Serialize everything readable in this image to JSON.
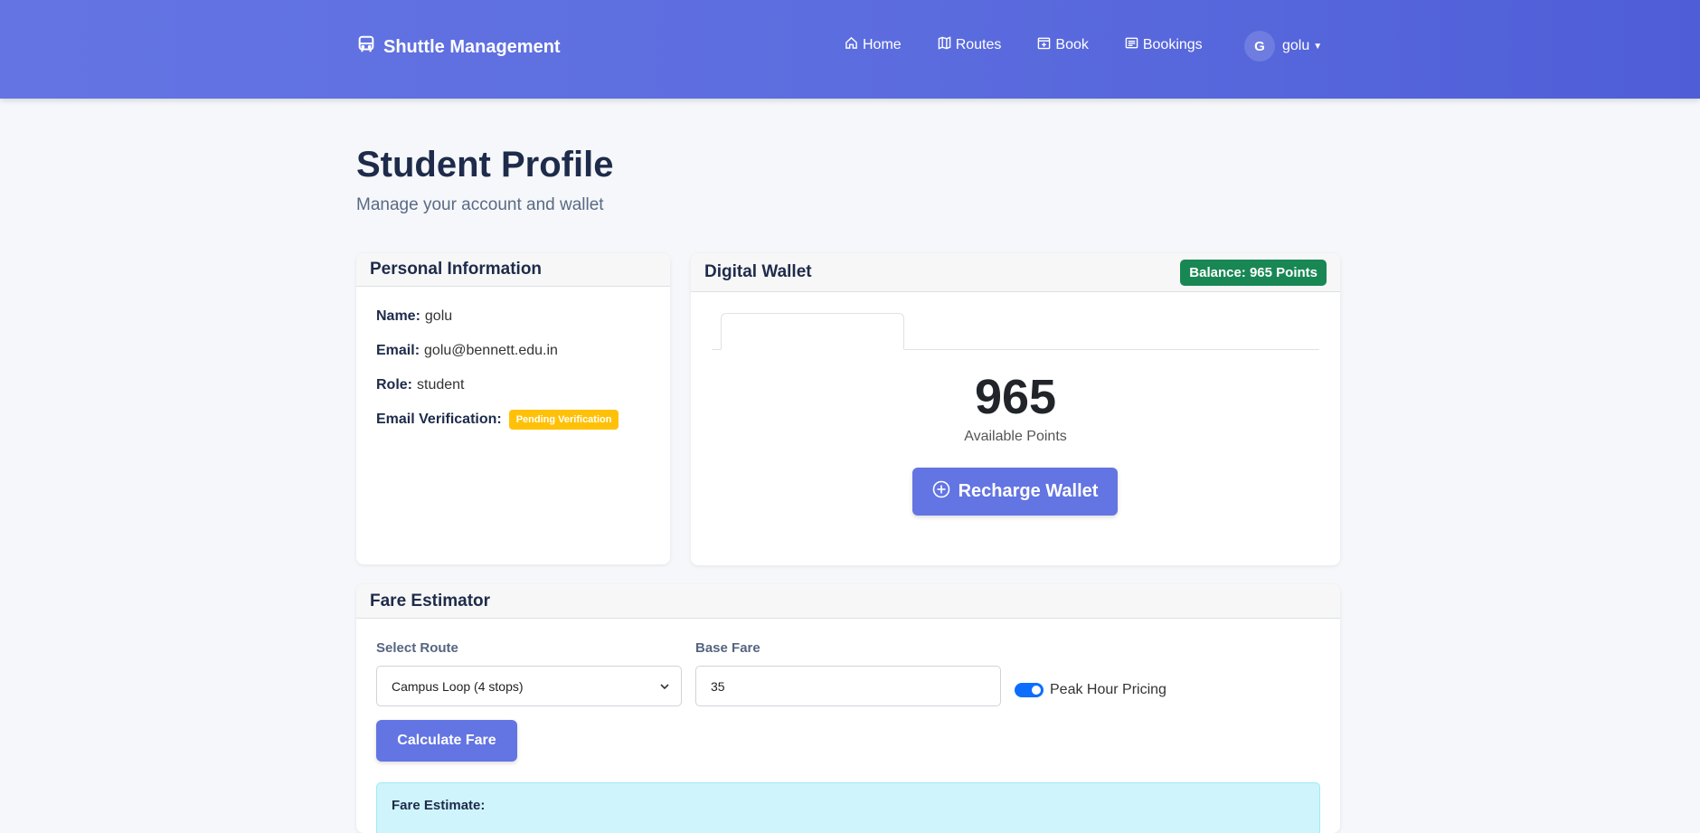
{
  "navbar": {
    "brand": "Shuttle Management",
    "links": [
      {
        "label": "Home",
        "icon": "home-icon"
      },
      {
        "label": "Routes",
        "icon": "map-icon"
      },
      {
        "label": "Book",
        "icon": "calendar-plus-icon"
      },
      {
        "label": "Bookings",
        "icon": "list-icon"
      }
    ],
    "user": {
      "initial": "G",
      "name": "golu"
    }
  },
  "header": {
    "title": "Student Profile",
    "subtitle": "Manage your account and wallet"
  },
  "personal_info": {
    "title": "Personal Information",
    "name_label": "Name:",
    "name_value": "golu",
    "email_label": "Email:",
    "email_value": "golu@bennett.edu.in",
    "role_label": "Role:",
    "role_value": "student",
    "verification_label": "Email Verification:",
    "verification_status": "Pending Verification"
  },
  "wallet": {
    "title": "Digital Wallet",
    "balance_badge": "Balance: 965 Points",
    "points": "965",
    "points_label": "Available Points",
    "recharge_label": "Recharge Wallet"
  },
  "fare_estimator": {
    "title": "Fare Estimator",
    "route_label": "Select Route",
    "route_value": "Campus Loop (4 stops)",
    "base_fare_label": "Base Fare",
    "base_fare_value": "35",
    "peak_label": "Peak Hour Pricing",
    "peak_enabled": true,
    "calculate_label": "Calculate Fare",
    "estimate_label": "Fare Estimate:"
  },
  "colors": {
    "navbar": "#5c6ddf",
    "primary_button": "#6374e3",
    "balance_badge": "#198754",
    "warning_badge": "#ffc107",
    "toggle": "#0d6efd",
    "info_box": "#cff4fc"
  }
}
